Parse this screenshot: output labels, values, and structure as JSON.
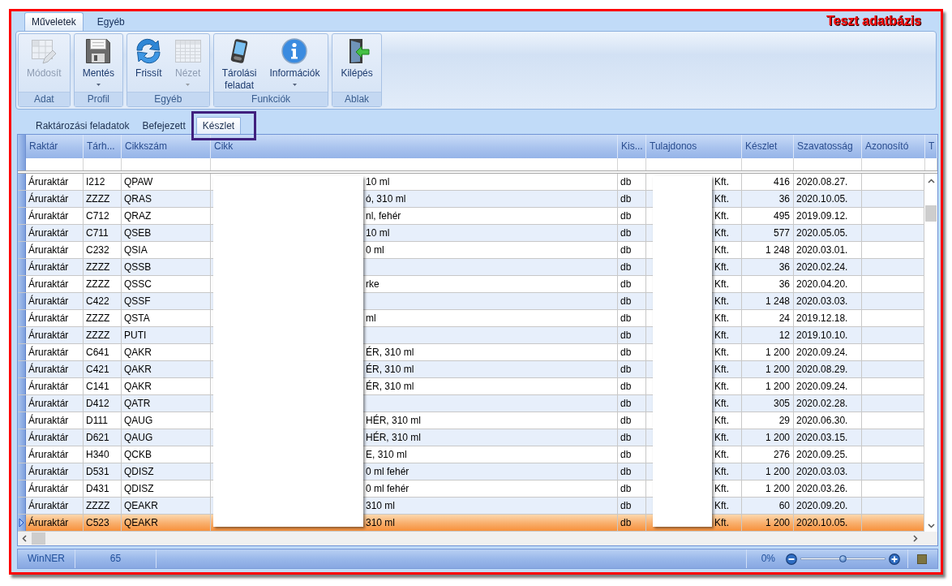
{
  "ribbon": {
    "tabs": [
      {
        "label": "Műveletek",
        "selected": true
      },
      {
        "label": "Egyéb",
        "selected": false
      }
    ],
    "title": "Teszt adatbázis",
    "groups": [
      {
        "label": "Adat",
        "buttons": [
          {
            "label": "Módosít",
            "disabled": true,
            "dropdown": false
          }
        ]
      },
      {
        "label": "Profil",
        "buttons": [
          {
            "label": "Mentés",
            "disabled": false,
            "dropdown": true
          }
        ]
      },
      {
        "label": "Egyéb",
        "buttons": [
          {
            "label": "Frissít",
            "disabled": false,
            "dropdown": false
          },
          {
            "label": "Nézet",
            "disabled": true,
            "dropdown": true
          }
        ]
      },
      {
        "label": "Funkciók",
        "buttons": [
          {
            "label": "Tárolási feladat",
            "disabled": false,
            "dropdown": false
          },
          {
            "label": "Információk",
            "disabled": false,
            "dropdown": true
          }
        ]
      },
      {
        "label": "Ablak",
        "buttons": [
          {
            "label": "Kilépés",
            "disabled": false,
            "dropdown": false
          }
        ]
      }
    ]
  },
  "view_tabs": [
    {
      "label": "Raktározási feladatok",
      "selected": false
    },
    {
      "label": "Befejezett",
      "selected": false
    },
    {
      "label": "Készlet",
      "selected": true
    }
  ],
  "table": {
    "columns": [
      "Raktár",
      "Tárh...",
      "Cikkszám",
      "Cikk",
      "Kis...",
      "Tulajdonos",
      "Készlet",
      "Szavatosság",
      "Azonosító",
      "T"
    ],
    "rows": [
      {
        "raktar": "Áruraktár",
        "tarh": "I212",
        "cikkszam": "QPAW",
        "cikk": "10 ml",
        "kis": "db",
        "tulajdonos": "Kft.",
        "keszlet": "416",
        "szavatossag": "2020.08.27.",
        "selected": false
      },
      {
        "raktar": "Áruraktár",
        "tarh": "ZZZZ",
        "cikkszam": "QRAS",
        "cikk": "ó, 310 ml",
        "kis": "db",
        "tulajdonos": "Kft.",
        "keszlet": "36",
        "szavatossag": "2020.10.05.",
        "selected": false
      },
      {
        "raktar": "Áruraktár",
        "tarh": "C712",
        "cikkszam": "QRAZ",
        "cikk": "nl, fehér",
        "kis": "db",
        "tulajdonos": "Kft.",
        "keszlet": "495",
        "szavatossag": "2019.09.12.",
        "selected": false
      },
      {
        "raktar": "Áruraktár",
        "tarh": "C711",
        "cikkszam": "QSEB",
        "cikk": "10 ml",
        "kis": "db",
        "tulajdonos": "Kft.",
        "keszlet": "577",
        "szavatossag": "2020.05.05.",
        "selected": false
      },
      {
        "raktar": "Áruraktár",
        "tarh": "C232",
        "cikkszam": "QSIA",
        "cikk": "0 ml",
        "kis": "db",
        "tulajdonos": "Kft.",
        "keszlet": "1 248",
        "szavatossag": "2020.03.01.",
        "selected": false
      },
      {
        "raktar": "Áruraktár",
        "tarh": "ZZZZ",
        "cikkszam": "QSSB",
        "kis": "db",
        "tulajdonos": "Kft.",
        "keszlet": "36",
        "szavatossag": "2020.02.24.",
        "selected": false
      },
      {
        "raktar": "Áruraktár",
        "tarh": "ZZZZ",
        "cikkszam": "QSSC",
        "cikk": "rke",
        "kis": "db",
        "tulajdonos": "Kft.",
        "keszlet": "36",
        "szavatossag": "2020.04.20.",
        "selected": false
      },
      {
        "raktar": "Áruraktár",
        "tarh": "C422",
        "cikkszam": "QSSF",
        "kis": "db",
        "tulajdonos": "Kft.",
        "keszlet": "1 248",
        "szavatossag": "2020.03.03.",
        "selected": false
      },
      {
        "raktar": "Áruraktár",
        "tarh": "ZZZZ",
        "cikkszam": "QSTA",
        "cikk": "ml",
        "kis": "db",
        "tulajdonos": "Kft.",
        "keszlet": "24",
        "szavatossag": "2019.12.18.",
        "selected": false
      },
      {
        "raktar": "Áruraktár",
        "tarh": "ZZZZ",
        "cikkszam": "PUTI",
        "kis": "db",
        "tulajdonos": "Kft.",
        "keszlet": "12",
        "szavatossag": "2019.10.10.",
        "selected": false
      },
      {
        "raktar": "Áruraktár",
        "tarh": "C641",
        "cikkszam": "QAKR",
        "cikk": "ÉR, 310 ml",
        "kis": "db",
        "tulajdonos": "Kft.",
        "keszlet": "1 200",
        "szavatossag": "2020.09.24.",
        "selected": false
      },
      {
        "raktar": "Áruraktár",
        "tarh": "C421",
        "cikkszam": "QAKR",
        "cikk": "ÉR, 310 ml",
        "kis": "db",
        "tulajdonos": "Kft.",
        "keszlet": "1 200",
        "szavatossag": "2020.08.29.",
        "selected": false
      },
      {
        "raktar": "Áruraktár",
        "tarh": "C141",
        "cikkszam": "QAKR",
        "cikk": "ÉR, 310 ml",
        "kis": "db",
        "tulajdonos": "Kft.",
        "keszlet": "1 200",
        "szavatossag": "2020.09.24.",
        "selected": false
      },
      {
        "raktar": "Áruraktár",
        "tarh": "D412",
        "cikkszam": "QATR",
        "kis": "db",
        "tulajdonos": "Kft.",
        "keszlet": "305",
        "szavatossag": "2020.02.28.",
        "selected": false
      },
      {
        "raktar": "Áruraktár",
        "tarh": "D111",
        "cikkszam": "QAUG",
        "cikk": "HÉR, 310 ml",
        "kis": "db",
        "tulajdonos": "Kft.",
        "keszlet": "29",
        "szavatossag": "2020.06.30.",
        "selected": false
      },
      {
        "raktar": "Áruraktár",
        "tarh": "D621",
        "cikkszam": "QAUG",
        "cikk": "HÉR, 310 ml",
        "kis": "db",
        "tulajdonos": "Kft.",
        "keszlet": "1 200",
        "szavatossag": "2020.03.15.",
        "selected": false
      },
      {
        "raktar": "Áruraktár",
        "tarh": "H340",
        "cikkszam": "QCKB",
        "cikk": "E, 310 ml",
        "kis": "db",
        "tulajdonos": "Kft.",
        "keszlet": "276",
        "szavatossag": "2020.09.25.",
        "selected": false
      },
      {
        "raktar": "Áruraktár",
        "tarh": "D531",
        "cikkszam": "QDISZ",
        "cikk": "0 ml fehér",
        "kis": "db",
        "tulajdonos": "Kft.",
        "keszlet": "1 200",
        "szavatossag": "2020.03.03.",
        "selected": false
      },
      {
        "raktar": "Áruraktár",
        "tarh": "D431",
        "cikkszam": "QDISZ",
        "cikk": "0 ml fehér",
        "kis": "db",
        "tulajdonos": "Kft.",
        "keszlet": "1 200",
        "szavatossag": "2020.03.26.",
        "selected": false
      },
      {
        "raktar": "Áruraktár",
        "tarh": "ZZZZ",
        "cikkszam": "QEAKR",
        "cikk": "310 ml",
        "kis": "db",
        "tulajdonos": "Kft.",
        "keszlet": "60",
        "szavatossag": "2020.09.20.",
        "selected": false
      },
      {
        "raktar": "Áruraktár",
        "tarh": "C523",
        "cikkszam": "QEAKR",
        "cikk": "310 ml",
        "kis": "db",
        "tulajdonos": "Kft.",
        "keszlet": "1 200",
        "szavatossag": "2020.10.05.",
        "selected": true
      }
    ]
  },
  "status_bar": {
    "panels": [
      "WinNER",
      "65"
    ],
    "zoom": {
      "reading": "0%",
      "level": 0.5
    }
  }
}
